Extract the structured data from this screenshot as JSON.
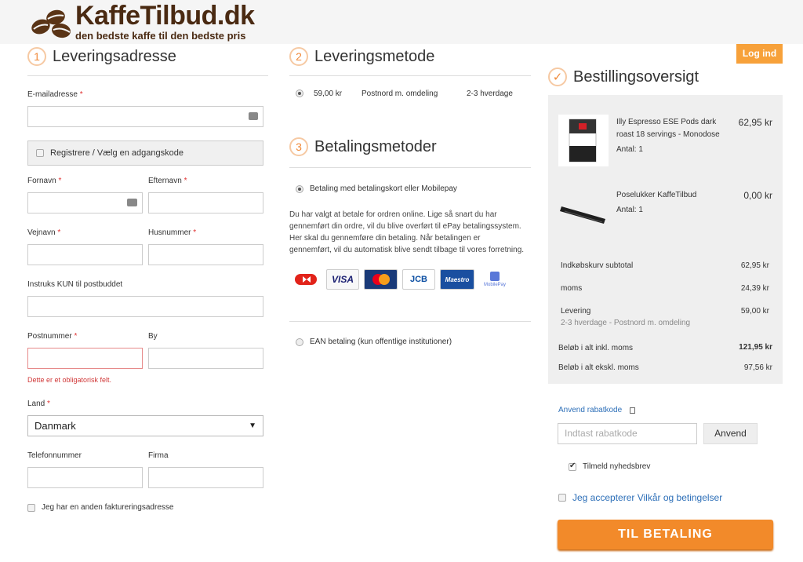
{
  "brand": {
    "name": "KaffeTilbud.dk",
    "tagline": "den bedste kaffe til den bedste pris"
  },
  "header": {
    "login_label": "Log ind"
  },
  "address": {
    "step": "1",
    "title": "Leveringsadresse",
    "email_label": "E-mailadresse",
    "register_label": "Registrere / Vælg en adgangskode",
    "firstname_label": "Fornavn",
    "lastname_label": "Efternavn",
    "street_label": "Vejnavn",
    "housenumber_label": "Husnummer",
    "instructions_label": "Instruks KUN til postbuddet",
    "postcode_label": "Postnummer",
    "city_label": "By",
    "error_text": "Dette er et obligatorisk felt.",
    "country_label": "Land",
    "country_value": "Danmark",
    "phone_label": "Telefonnummer",
    "company_label": "Firma",
    "billing_label": "Jeg har en anden faktureringsadresse",
    "required_mark": "*"
  },
  "shipping": {
    "step": "2",
    "title": "Leveringsmetode",
    "price": "59,00 kr",
    "carrier": "Postnord m. omdeling",
    "time": "2-3 hverdage"
  },
  "payment": {
    "step": "3",
    "title": "Betalingsmetoder",
    "card_option": "Betaling med betalingskort eller Mobilepay",
    "description": "Du har valgt at betale for ordren online. Lige så snart du har gennemført din ordre, vil du blive overført til ePay betalingssystem. Her skal du gennemføre din betaling. Når betalingen er gennemført, vil du automatisk blive sendt tilbage til vores forretning.",
    "logos": [
      "VISA",
      "MasterCard",
      "JCB",
      "Maestro",
      "MobilePay"
    ],
    "ean_option": "EAN betaling (kun offentlige institutioner)"
  },
  "summary": {
    "title": "Bestillingsoversigt",
    "items": [
      {
        "name_line1": "Illy Espresso ESE Pods dark",
        "name_line2": "roast 18 servings - Monodose",
        "qty": "Antal: 1",
        "price": "62,95 kr"
      },
      {
        "name_line1": "Poselukker KaffeTilbud",
        "qty": "Antal: 1",
        "price": "0,00 kr"
      }
    ],
    "subtotal_label": "Indkøbskurv subtotal",
    "subtotal_value": "62,95 kr",
    "vat_label": "moms",
    "vat_value": "24,39 kr",
    "delivery_label": "Levering",
    "delivery_sub": "2-3 hverdage - Postnord m. omdeling",
    "delivery_value": "59,00 kr",
    "total_incl_label": "Beløb i alt inkl. moms",
    "total_incl_value": "121,95 kr",
    "total_excl_label": "Beløb i alt ekskl. moms",
    "total_excl_value": "97,56 kr"
  },
  "coupon": {
    "toggle_label": "Anvend rabatkode",
    "placeholder": "Indtast rabatkode",
    "apply_label": "Anvend"
  },
  "newsletter_label": "Tilmeld nyhedsbrev",
  "terms_label": "Jeg accepterer Vilkår og betingelser",
  "checkout_label": "TIL BETALING",
  "colors": {
    "accent": "#f28a2a",
    "brand": "#4a2a12",
    "link": "#2d6fb8",
    "error": "#d13a3a"
  }
}
